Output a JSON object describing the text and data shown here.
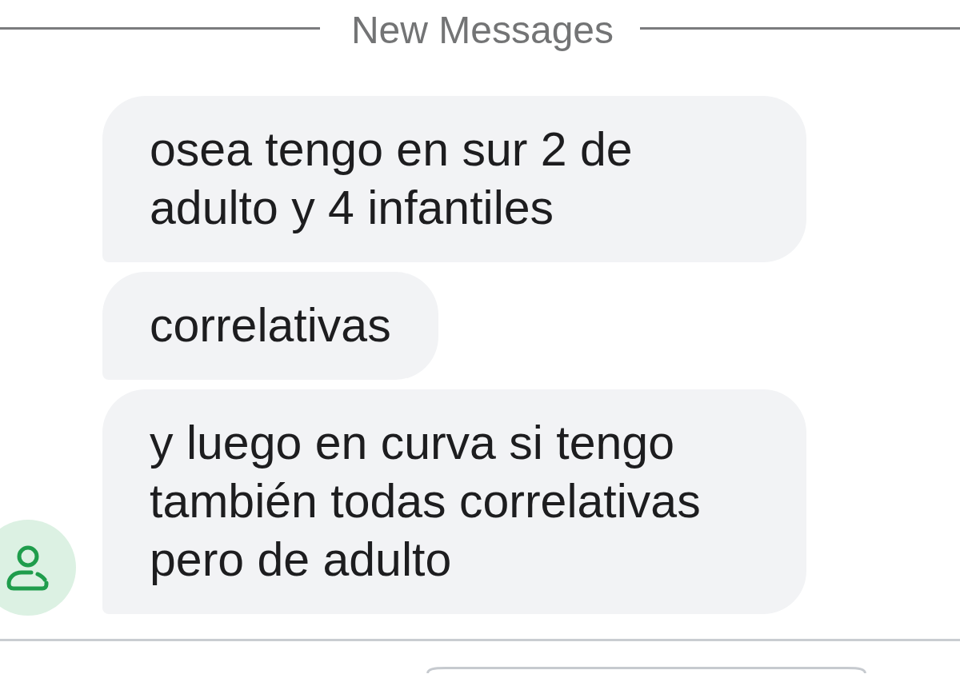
{
  "divider": {
    "label": "New Messages"
  },
  "messages": [
    {
      "text": "osea tengo en sur 2 de adulto y 4 infantiles",
      "avatar": false
    },
    {
      "text": "correlativas",
      "avatar": false
    },
    {
      "text": "y luego en curva si tengo también todas correlativas pero de adulto",
      "avatar": true
    }
  ]
}
